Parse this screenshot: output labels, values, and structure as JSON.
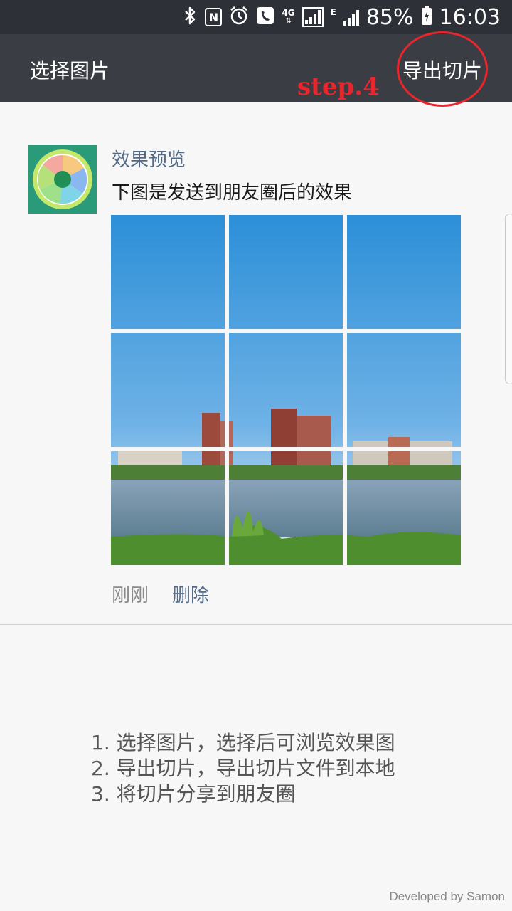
{
  "status_bar": {
    "battery": "85%",
    "time": "16:03",
    "network": "4G",
    "network2": "E",
    "nfc": "N",
    "icons": [
      "bluetooth-icon",
      "nfc-icon",
      "alarm-icon",
      "phone-icon",
      "signal-icon",
      "battery-icon"
    ]
  },
  "app_bar": {
    "select_label": "选择图片",
    "export_label": "导出切片"
  },
  "annotation": {
    "step_label": "step.4",
    "color": "#e8262e"
  },
  "card": {
    "title": "效果预览",
    "description": "下图是发送到朋友圈后的效果",
    "time": "刚刚",
    "delete_label": "删除"
  },
  "instructions": [
    "1. 选择图片，选择后可浏览效果图",
    "2. 导出切片，导出切片文件到本地",
    "3. 将切片分享到朋友圈"
  ],
  "footer": "Developed by Samon",
  "colors": {
    "status_bar": "#2d3036",
    "app_bar": "#3a3d44",
    "link": "#536a88",
    "background": "#f7f7f7"
  }
}
